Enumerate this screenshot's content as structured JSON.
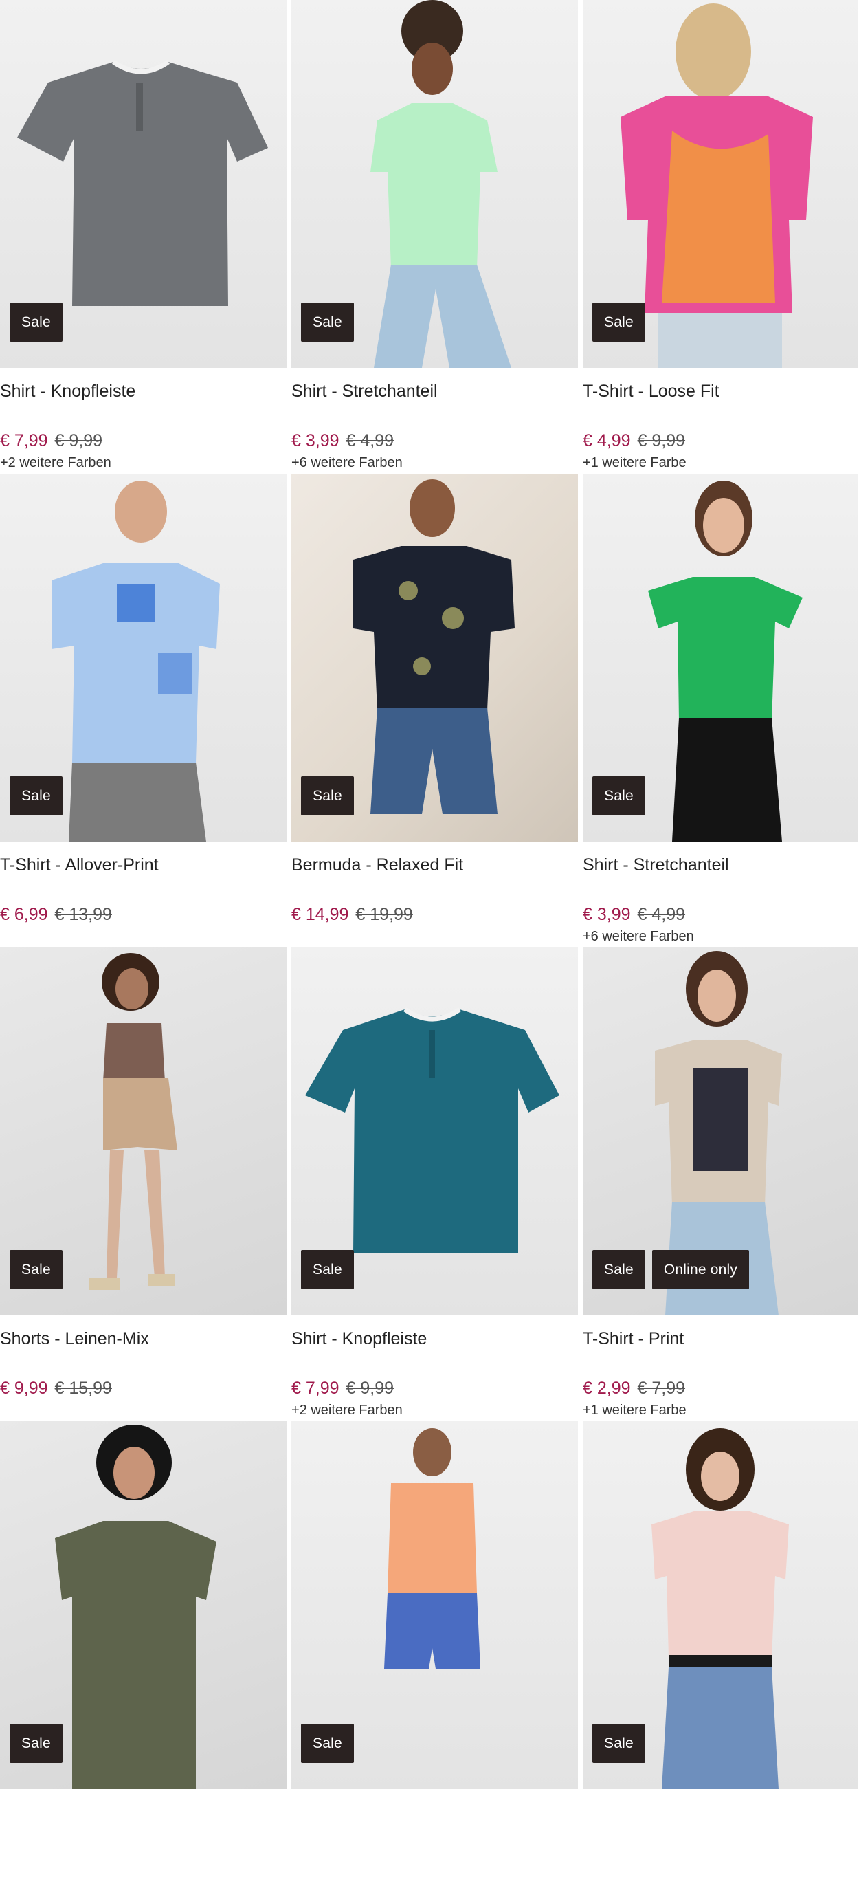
{
  "badges": {
    "sale": "Sale",
    "online_only": "Online only"
  },
  "products": [
    {
      "title": "Shirt - Knopfleiste",
      "price": "€ 7,99",
      "old_price": "€ 9,99",
      "colors": "+2 weitere Farben",
      "image": "grey-henley-shirt"
    },
    {
      "title": "Shirt - Stretchanteil",
      "price": "€ 3,99",
      "old_price": "€ 4,99",
      "colors": "+6 weitere Farben",
      "image": "mint-green-tshirt-model"
    },
    {
      "title": "T-Shirt - Loose Fit",
      "price": "€ 4,99",
      "old_price": "€ 9,99",
      "colors": "+1 weitere Farbe",
      "image": "pink-paisley-tshirt-back"
    },
    {
      "title": "T-Shirt - Allover-Print",
      "price": "€ 6,99",
      "old_price": "€ 13,99",
      "colors": "",
      "image": "blue-patchwork-tshirt-model"
    },
    {
      "title": "Bermuda - Relaxed Fit",
      "price": "€ 14,99",
      "old_price": "€ 19,99",
      "colors": "",
      "image": "denim-bermuda-model"
    },
    {
      "title": "Shirt - Stretchanteil",
      "price": "€ 3,99",
      "old_price": "€ 4,99",
      "colors": "+6 weitere Farben",
      "image": "green-tshirt-model"
    },
    {
      "title": "Shorts - Leinen-Mix",
      "price": "€ 9,99",
      "old_price": "€ 15,99",
      "colors": "",
      "image": "paisley-shorts-model"
    },
    {
      "title": "Shirt - Knopfleiste",
      "price": "€ 7,99",
      "old_price": "€ 9,99",
      "colors": "+2 weitere Farben",
      "image": "petrol-henley-shirt"
    },
    {
      "title": "T-Shirt - Print",
      "price": "€ 2,99",
      "old_price": "€ 7,99",
      "colors": "+1 weitere Farbe",
      "image": "beige-print-tshirt-model",
      "online_only": true
    },
    {
      "title": "",
      "price": "",
      "old_price": "",
      "colors": "",
      "image": "olive-blouse-model"
    },
    {
      "title": "",
      "price": "",
      "old_price": "",
      "colors": "",
      "image": "orange-hoodie-vest-model"
    },
    {
      "title": "",
      "price": "",
      "old_price": "",
      "colors": "",
      "image": "rose-butterfly-tshirt-model"
    }
  ],
  "colors": {
    "price": "#a01a4c",
    "badge_bg": "#2a2221"
  }
}
